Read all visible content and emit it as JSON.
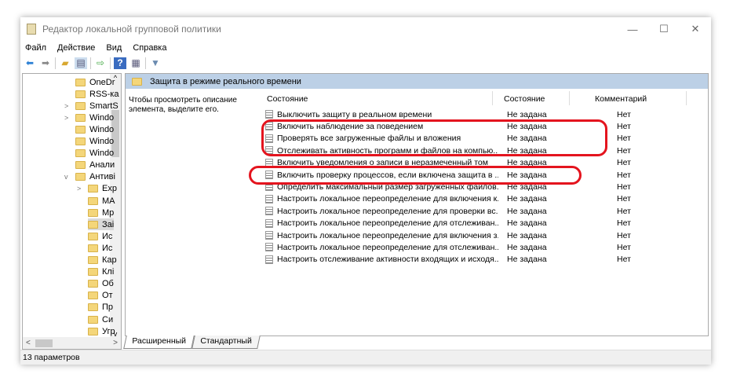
{
  "window": {
    "title": "Редактор локальной групповой политики",
    "minimize": "—",
    "maximize": "☐",
    "close": "✕"
  },
  "menu": [
    "Файл",
    "Действие",
    "Вид",
    "Справка"
  ],
  "toolbar": [
    "back-icon",
    "forward-icon",
    "up-folder-icon",
    "show-hide-tree-icon",
    "export-list-icon",
    "help-icon",
    "extended-view-icon",
    "filter-icon"
  ],
  "tree": [
    {
      "label": "OneDr",
      "indent": 0,
      "exp": ""
    },
    {
      "label": "RSS-ка",
      "indent": 0,
      "exp": ""
    },
    {
      "label": "SmartS",
      "indent": 0,
      "exp": ">"
    },
    {
      "label": "Windo",
      "indent": 0,
      "exp": ">"
    },
    {
      "label": "Windo",
      "indent": 0,
      "exp": ""
    },
    {
      "label": "Windo",
      "indent": 0,
      "exp": ""
    },
    {
      "label": "Windo",
      "indent": 0,
      "exp": ""
    },
    {
      "label": "Анали",
      "indent": 0,
      "exp": ""
    },
    {
      "label": "Антиві",
      "indent": 0,
      "exp": "v"
    },
    {
      "label": "Exp",
      "indent": 1,
      "exp": ">"
    },
    {
      "label": "MA",
      "indent": 1,
      "exp": ""
    },
    {
      "label": "Mp",
      "indent": 1,
      "exp": ""
    },
    {
      "label": "Заі",
      "indent": 1,
      "exp": "",
      "selected": true
    },
    {
      "label": "Ис",
      "indent": 1,
      "exp": ""
    },
    {
      "label": "Ис",
      "indent": 1,
      "exp": ""
    },
    {
      "label": "Кар",
      "indent": 1,
      "exp": ""
    },
    {
      "label": "Клі",
      "indent": 1,
      "exp": ""
    },
    {
      "label": "Об",
      "indent": 1,
      "exp": ""
    },
    {
      "label": "От",
      "indent": 1,
      "exp": ""
    },
    {
      "label": "Пр",
      "indent": 1,
      "exp": ""
    },
    {
      "label": "Си",
      "indent": 1,
      "exp": ""
    },
    {
      "label": "Угр",
      "indent": 1,
      "exp": ""
    }
  ],
  "folder_header": "Защита в режиме реального времени",
  "description": "Чтобы просмотреть описание элемента, выделите его.",
  "columns": {
    "name": "Состояние",
    "state": "Состояние",
    "comment": "Комментарий"
  },
  "rows": [
    {
      "name": "Выключить защиту в реальном времени",
      "state": "Не задана",
      "comment": "Нет"
    },
    {
      "name": "Включить наблюдение за поведением",
      "state": "Не задана",
      "comment": "Нет"
    },
    {
      "name": "Проверять все загруженные файлы и вложения",
      "state": "Не задана",
      "comment": "Нет"
    },
    {
      "name": "Отслеживать активность программ и файлов на компью...",
      "state": "Не задана",
      "comment": "Нет"
    },
    {
      "name": "Включить уведомления о записи в неразмеченный том",
      "state": "Не задана",
      "comment": "Нет"
    },
    {
      "name": "Включить проверку процессов, если включена защита в ...",
      "state": "Не задана",
      "comment": "Нет"
    },
    {
      "name": "Определить максимальный размер загруженных файлов...",
      "state": "Не задана",
      "comment": "Нет"
    },
    {
      "name": "Настроить локальное переопределение для включения к...",
      "state": "Не задана",
      "comment": "Нет"
    },
    {
      "name": "Настроить локальное переопределение для проверки вс...",
      "state": "Не задана",
      "comment": "Нет"
    },
    {
      "name": "Настроить локальное переопределение для отслеживан...",
      "state": "Не задана",
      "comment": "Нет"
    },
    {
      "name": "Настроить локальное переопределение для включения з...",
      "state": "Не задана",
      "comment": "Нет"
    },
    {
      "name": "Настроить локальное переопределение для отслеживан...",
      "state": "Не задана",
      "comment": "Нет"
    },
    {
      "name": "Настроить отслеживание активности входящих и исходя...",
      "state": "Не задана",
      "comment": "Нет"
    }
  ],
  "tabs": [
    "Расширенный",
    "Стандартный"
  ],
  "status": "13 параметров",
  "colors": {
    "highlight": "#e4141e",
    "header_band": "#bcd0e6"
  }
}
